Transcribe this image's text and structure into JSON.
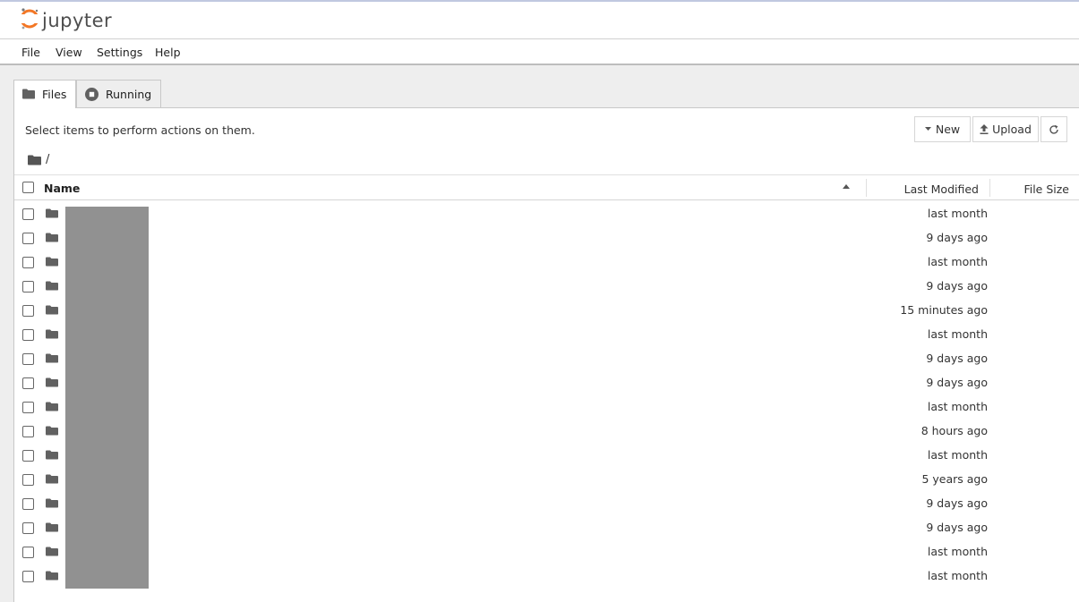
{
  "app": {
    "logo_text": "jupyter"
  },
  "menu": [
    "File",
    "View",
    "Settings",
    "Help"
  ],
  "tabs": {
    "files": "Files",
    "running": "Running"
  },
  "toolbar": {
    "hint": "Select items to perform actions on them.",
    "new_label": "New",
    "upload_label": "Upload"
  },
  "breadcrumb": {
    "path": "/"
  },
  "columns": {
    "name": "Name",
    "last_modified": "Last Modified",
    "file_size": "File Size"
  },
  "colors": {
    "logo_orange": "#f37726",
    "folder_icon": "#616161",
    "redaction": "#919191"
  },
  "rows": [
    {
      "type": "folder",
      "name": "",
      "modified": "last month"
    },
    {
      "type": "folder",
      "name": "",
      "modified": "9 days ago"
    },
    {
      "type": "folder",
      "name": "",
      "modified": "last month"
    },
    {
      "type": "folder",
      "name": "",
      "modified": "9 days ago"
    },
    {
      "type": "folder",
      "name": "",
      "modified": "15 minutes ago"
    },
    {
      "type": "folder",
      "name": "",
      "modified": "last month"
    },
    {
      "type": "folder",
      "name": "",
      "modified": "9 days ago"
    },
    {
      "type": "folder",
      "name": "",
      "modified": "9 days ago"
    },
    {
      "type": "folder",
      "name": "",
      "modified": "last month"
    },
    {
      "type": "folder",
      "name": "",
      "modified": "8 hours ago"
    },
    {
      "type": "folder",
      "name": "",
      "modified": "last month"
    },
    {
      "type": "folder",
      "name": "",
      "modified": "5 years ago"
    },
    {
      "type": "folder",
      "name": "",
      "modified": "9 days ago"
    },
    {
      "type": "folder",
      "name": "",
      "modified": "9 days ago"
    },
    {
      "type": "folder",
      "name": "",
      "modified": "last month"
    },
    {
      "type": "folder",
      "name": "",
      "modified": "last month"
    }
  ]
}
